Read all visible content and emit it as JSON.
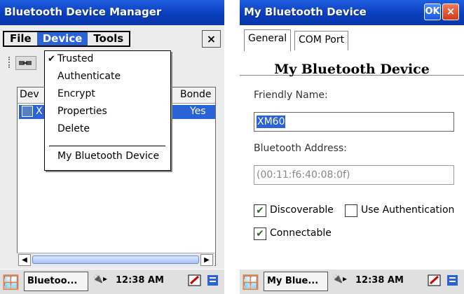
{
  "left": {
    "title": "Bluetooth Device Manager",
    "menus": [
      "File",
      "Device",
      "Tools"
    ],
    "close_glyph": "×",
    "columns": {
      "device": "Dev",
      "bonded": "Bonde"
    },
    "row": {
      "device_partial": "X",
      "bonded": "Yes"
    },
    "dropdown": {
      "items": [
        "Trusted",
        "Authenticate",
        "Encrypt",
        "Properties",
        "Delete"
      ],
      "checked_item": "Trusted",
      "last_item": "My Bluetooth Device"
    },
    "taskbar": {
      "task": "Bluetoo...",
      "clock": "12:38 AM"
    }
  },
  "right": {
    "title": "My Bluetooth Device",
    "ok_label": "OK",
    "close_glyph": "×",
    "tabs": [
      "General",
      "COM Port"
    ],
    "heading": "My Bluetooth Device",
    "friendly_name_label": "Friendly Name:",
    "friendly_name_value": "XM60",
    "address_label": "Bluetooth Address:",
    "address_value": "(00:11:f6:40:08:0f)",
    "checkboxes": {
      "discoverable": {
        "label": "Discoverable",
        "checked": true
      },
      "use_auth": {
        "label": "Use Authentication",
        "checked": false
      },
      "connectable": {
        "label": "Connectable",
        "checked": true
      }
    },
    "taskbar": {
      "task": "My Blue...",
      "clock": "12:38 AM"
    }
  },
  "colors": {
    "titlebar": "#0a3dbd",
    "selection": "#2a63d8",
    "menu_bg": "#ececec"
  },
  "icons": [
    "start-flag-icon",
    "bluetooth-tray-icon",
    "network-tray-icon",
    "keyboard-icon",
    "device-icon"
  ]
}
